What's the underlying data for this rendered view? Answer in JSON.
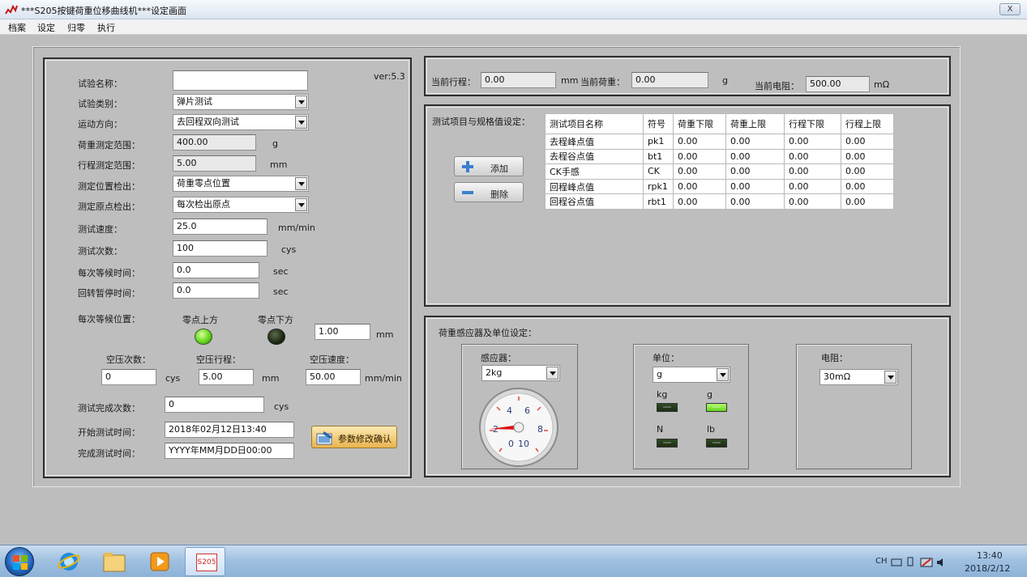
{
  "window": {
    "title": "***S205按键荷重位移曲线机***设定画面",
    "close": "X"
  },
  "menu": [
    "档案",
    "设定",
    "归零",
    "执行"
  ],
  "left": {
    "version": "ver:5.3",
    "rows": [
      {
        "label": "试验名称：",
        "value": "",
        "kind": "input"
      },
      {
        "label": "试验类别：",
        "value": "弹片测试",
        "kind": "combo"
      },
      {
        "label": "运动方向：",
        "value": "去回程双向测试",
        "kind": "combo"
      },
      {
        "label": "荷重测定范围：",
        "value": "400.00",
        "unit": "g",
        "kind": "ro"
      },
      {
        "label": "行程测定范围：",
        "value": "5.00",
        "unit": "mm",
        "kind": "ro"
      },
      {
        "label": "测定位置检出：",
        "value": "荷重零点位置",
        "kind": "combo"
      },
      {
        "label": "测定原点检出：",
        "value": "每次检出原点",
        "kind": "combo"
      },
      {
        "label": "测试速度：",
        "value": "25.0",
        "unit": "mm/min",
        "kind": "input"
      },
      {
        "label": "测试次数：",
        "value": "100",
        "unit": "cys",
        "kind": "input"
      },
      {
        "label": "每次等候时间：",
        "value": "0.0",
        "unit": "sec",
        "kind": "input"
      },
      {
        "label": "回转暂停时间：",
        "value": "0.0",
        "unit": "sec",
        "kind": "input"
      }
    ],
    "wait_position": {
      "label": "每次等候位置：",
      "above": "零点上方",
      "below": "零点下方",
      "value": "1.00",
      "unit": "mm"
    },
    "air": {
      "count_label": "空压次数：",
      "count_value": "0",
      "count_unit": "cys",
      "stroke_label": "空压行程：",
      "stroke_value": "5.00",
      "stroke_unit": "mm",
      "speed_label": "空压速度：",
      "speed_value": "50.00",
      "speed_unit": "mm/min"
    },
    "completed": {
      "label": "测试完成次数：",
      "value": "0",
      "unit": "cys"
    },
    "start_time": {
      "label": "开始测试时间：",
      "value": "2018年02月12日13:40"
    },
    "end_time": {
      "label": "完成测试时间：",
      "value": "YYYY年MM月DD日00:00"
    },
    "confirm_button": "参数修改确认"
  },
  "status": {
    "stroke": {
      "label": "当前行程：",
      "value": "0.00",
      "unit": "mm"
    },
    "load": {
      "label": "当前荷重：",
      "value": "0.00",
      "unit": "g"
    },
    "resistance": {
      "label": "当前电阻：",
      "value": "500.00",
      "unit": "mΩ"
    }
  },
  "spec": {
    "title": "测试项目与规格值设定：",
    "add": "添加",
    "delete": "删除",
    "headers": [
      "测试项目名称",
      "符号",
      "荷重下限",
      "荷重上限",
      "行程下限",
      "行程上限"
    ],
    "rows": [
      [
        "去程峰点值",
        "pk1",
        "0.00",
        "0.00",
        "0.00",
        "0.00"
      ],
      [
        "去程谷点值",
        "bt1",
        "0.00",
        "0.00",
        "0.00",
        "0.00"
      ],
      [
        "CK手感",
        "CK",
        "0.00",
        "0.00",
        "0.00",
        "0.00"
      ],
      [
        "回程峰点值",
        "rpk1",
        "0.00",
        "0.00",
        "0.00",
        "0.00"
      ],
      [
        "回程谷点值",
        "rbt1",
        "0.00",
        "0.00",
        "0.00",
        "0.00"
      ]
    ]
  },
  "sensor": {
    "title": "荷重感应器及单位设定：",
    "sensor_label": "感应器：",
    "sensor_value": "2kg",
    "gauge": {
      "ticks": [
        "0",
        "2",
        "4",
        "6",
        "8",
        "10"
      ],
      "value": 2
    },
    "unit_label": "单位：",
    "unit_value": "g",
    "units": [
      {
        "name": "kg",
        "on": false
      },
      {
        "name": "g",
        "on": true
      },
      {
        "name": "N",
        "on": false
      },
      {
        "name": "lb",
        "on": false
      }
    ],
    "res_label": "电阻：",
    "res_value": "30mΩ"
  },
  "taskbar": {
    "s205": "S205",
    "tray": "CH",
    "time": "13:40",
    "date": "2018/2/12"
  }
}
